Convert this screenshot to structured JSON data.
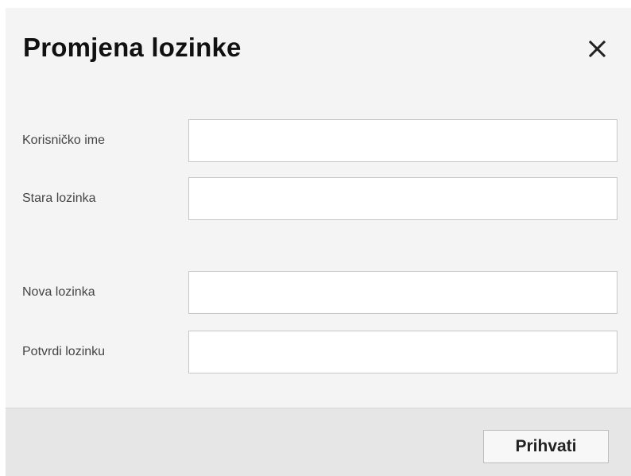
{
  "dialog": {
    "title": "Promjena lozinke",
    "close_icon": "close-icon"
  },
  "form": {
    "fields": [
      {
        "label": "Korisničko ime",
        "value": "",
        "placeholder": ""
      },
      {
        "label": "Stara lozinka",
        "value": "",
        "placeholder": ""
      },
      {
        "label": "Nova lozinka",
        "value": "",
        "placeholder": ""
      },
      {
        "label": "Potvrdi lozinku",
        "value": "",
        "placeholder": ""
      }
    ]
  },
  "footer": {
    "accept_label": "Prihvati"
  }
}
